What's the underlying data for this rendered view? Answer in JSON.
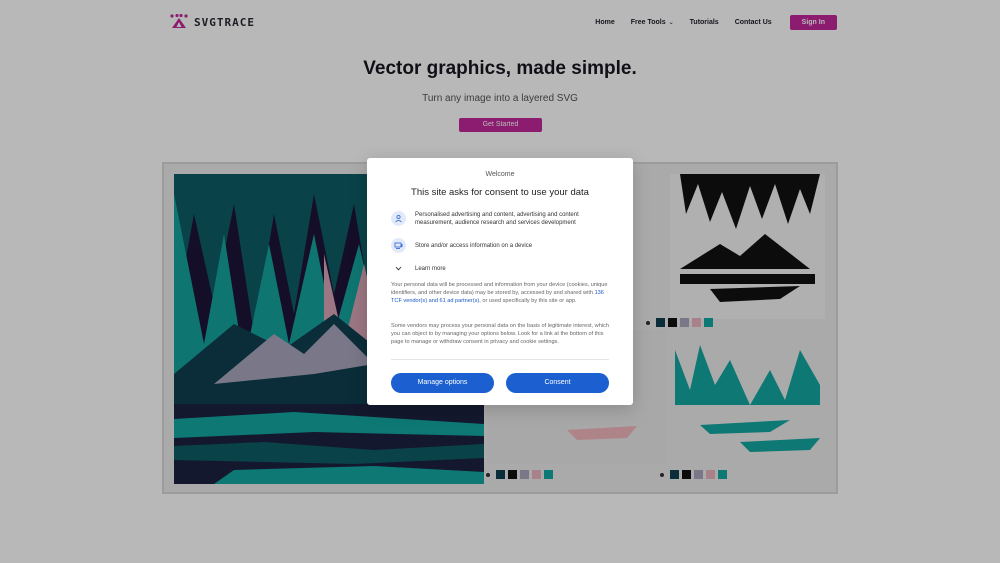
{
  "nav": {
    "brand": "SVGTRACE",
    "links": [
      {
        "label": "Home"
      },
      {
        "label": "Free Tools"
      },
      {
        "label": "Tutorials"
      },
      {
        "label": "Contact Us"
      }
    ],
    "sign_in": "Sign In"
  },
  "hero": {
    "title": "Vector graphics, made simple.",
    "subtitle": "Turn any image into a layered SVG",
    "cta": "Get Started"
  },
  "colors": {
    "brand": "#c2279b",
    "consent_button": "#1b5fd0",
    "palette": [
      "#0f3f4f",
      "#111111",
      "#a9a7bd",
      "#e9b4bd",
      "#13a7a1"
    ]
  },
  "consent": {
    "welcome": "Welcome",
    "title": "This site asks for consent to use your data",
    "purposes": [
      {
        "icon": "person-icon",
        "text": "Personalised advertising and content, advertising and content measurement, audience research and services development"
      },
      {
        "icon": "device-icon",
        "text": "Store and/or access information on a device"
      }
    ],
    "learn_more": "Learn more",
    "paragraph1_before": "Your personal data will be processed and information from your device (cookies, unique identifiers, and other device data) may be stored by, accessed by and shared with ",
    "paragraph1_link": "136 TCF vendor(s) and 61 ad partner(s)",
    "paragraph1_after": ", or used specifically by this site or app.",
    "paragraph2": "Some vendors may process your personal data on the basis of legitimate interest, which you can object to by managing your options below. Look for a link at the bottom of this page to manage or withdraw consent in privacy and cookie settings.",
    "manage_options": "Manage options",
    "consent_button": "Consent"
  }
}
